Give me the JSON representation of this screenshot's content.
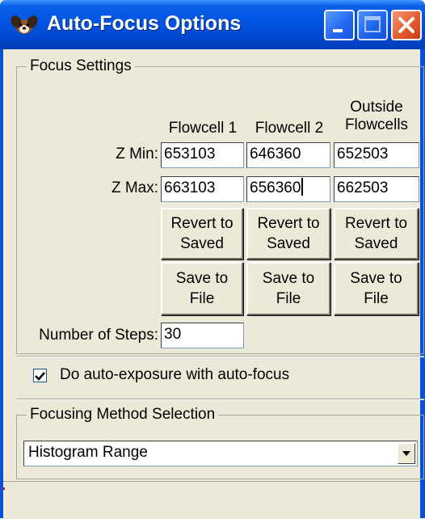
{
  "window": {
    "title": "Auto-Focus Options",
    "title_icon": "app-dog-icon",
    "caption_buttons": [
      "minimize-icon",
      "maximize-icon",
      "close-icon"
    ]
  },
  "focus_settings": {
    "group_title": "Focus Settings",
    "columns": [
      "Flowcell 1",
      "Flowcell 2",
      "Outside\nFlowcells"
    ],
    "rows": [
      {
        "label": "Z Min:",
        "values": [
          "653103",
          "646360",
          "652503"
        ]
      },
      {
        "label": "Z Max:",
        "values": [
          "663103",
          "656360",
          "662503"
        ]
      }
    ],
    "revert_label": "Revert to\nSaved",
    "save_label": "Save to\nFile",
    "steps_label": "Number of Steps:",
    "steps_value": "30"
  },
  "auto_exposure": {
    "label": "Do auto-exposure with auto-focus",
    "checked": true
  },
  "focusing_method": {
    "group_title": "Focusing Method Selection",
    "selected": "Histogram Range"
  },
  "colors": {
    "titlebar": "#0054e3",
    "window_bg": "#ece9d8",
    "close_button": "#e25a2e"
  }
}
